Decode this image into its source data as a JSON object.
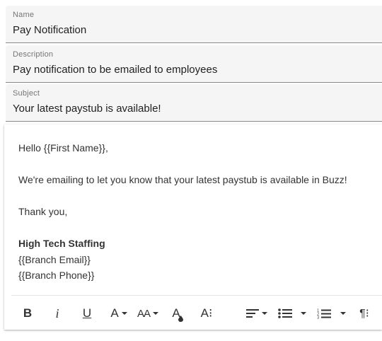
{
  "fields": {
    "name": {
      "label": "Name",
      "value": "Pay Notification"
    },
    "description": {
      "label": "Description",
      "value": "Pay notification to be emailed to employees"
    },
    "subject": {
      "label": "Subject",
      "value": "Your latest paystub is available!"
    }
  },
  "editor": {
    "greeting": "Hello {{First Name}},",
    "message": "We're emailing to let you know that your latest paystub is available in Buzz!",
    "closing": "Thank you,",
    "signature_company": "High Tech Staffing",
    "signature_email": "{{Branch Email}}",
    "signature_phone": "{{Branch Phone}}"
  },
  "toolbar": {
    "bold": "B",
    "italic": "i",
    "underline": "U",
    "font_family": "A",
    "font_size": "AA",
    "text_color": "A",
    "more_text": "A⁝",
    "more_lists": "¶⁝"
  }
}
